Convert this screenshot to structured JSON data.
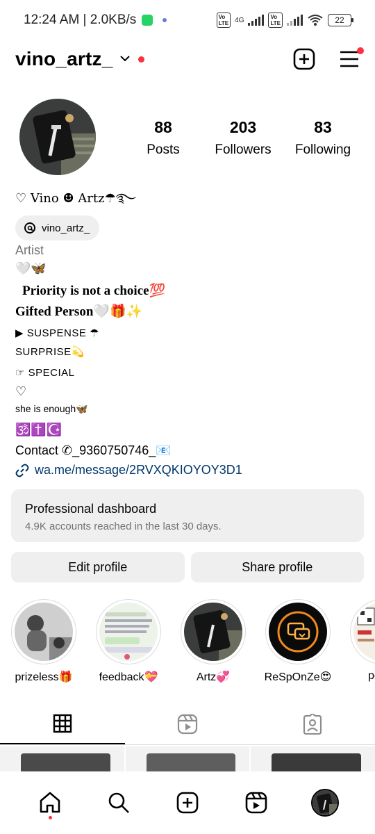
{
  "status_bar": {
    "time_speed": "12:24 AM | 2.0KB/s",
    "network_label": "4G",
    "volte_label": "Vo LTE",
    "battery": "22"
  },
  "header": {
    "username": "vino_artz_",
    "chevron": "⌄"
  },
  "stats": [
    {
      "value": "88",
      "label": "Posts"
    },
    {
      "value": "203",
      "label": "Followers"
    },
    {
      "value": "83",
      "label": "Following"
    }
  ],
  "profile": {
    "display_name": "♡ Vino ☻ Artz☂࿐",
    "threads_handle": "vino_artz_",
    "category": "Artist",
    "bio_lines": [
      "🤍🦋",
      "Priority is not a choice💯",
      "Gifted Person🤍🎁✨",
      "▶ SUSPENSE ☂",
      "SURPRISE💫",
      "☞ SPECIAL",
      "♡",
      "she is enough🦋",
      "🕉️✝️☪️",
      "Contact ✆_9360750746_📧"
    ],
    "link": "wa.me/message/2RVXQKIOYOY3D1"
  },
  "dashboard": {
    "title": "Professional dashboard",
    "subtitle": "4.9K accounts reached in the last 30 days."
  },
  "actions": {
    "edit": "Edit profile",
    "share": "Share profile"
  },
  "highlights": [
    {
      "label": "prizeless🎁"
    },
    {
      "label": "feedback💝"
    },
    {
      "label": "Artz💞"
    },
    {
      "label": "ReSpOnZe😍"
    },
    {
      "label": "pencil"
    }
  ],
  "icons": {
    "create": "plus-square-icon",
    "menu": "hamburger-menu-icon",
    "grid_tab": "grid-icon",
    "reels_tab": "reels-icon",
    "tagged_tab": "tagged-icon",
    "home": "home-icon",
    "search": "search-icon",
    "add": "add-post-icon",
    "reels": "reels-icon",
    "notification_color": "#ff3040",
    "link_color": "#00376b"
  }
}
